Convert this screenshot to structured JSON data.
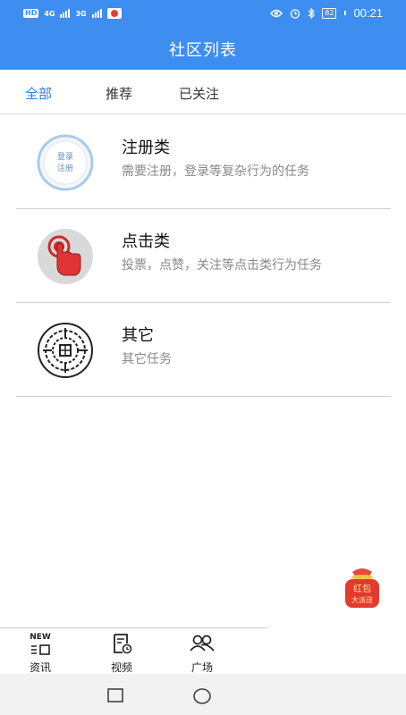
{
  "status_bar": {
    "hd_badge": "HD",
    "network_1": "4G",
    "network_2": "3G",
    "battery": "82",
    "time": "00:21"
  },
  "header": {
    "title": "社区列表"
  },
  "tabs": [
    {
      "label": "全部",
      "active": true
    },
    {
      "label": "推荐",
      "active": false
    },
    {
      "label": "已关注",
      "active": false
    }
  ],
  "communities": [
    {
      "title": "注册类",
      "desc": "需要注册，登录等复杂行为的任务",
      "icon": "login-register-badge-icon",
      "icon_text_1": "登录",
      "icon_text_2": "注册"
    },
    {
      "title": "点击类",
      "desc": "投票，点赞，关注等点击类行为任务",
      "icon": "finger-click-icon"
    },
    {
      "title": "其它",
      "desc": "其它任务",
      "icon": "seal-pattern-icon"
    }
  ],
  "floating": {
    "line1": "红包",
    "line2": "大派送"
  },
  "bottom_nav": [
    {
      "label": "资讯",
      "icon": "news-icon",
      "icon_text": "NEW"
    },
    {
      "label": "视频",
      "icon": "video-icon"
    },
    {
      "label": "广场",
      "icon": "people-icon"
    }
  ],
  "colors": {
    "brand": "#3d8ef0",
    "active_tab": "#2f7fd0",
    "desc_text": "#888888"
  }
}
